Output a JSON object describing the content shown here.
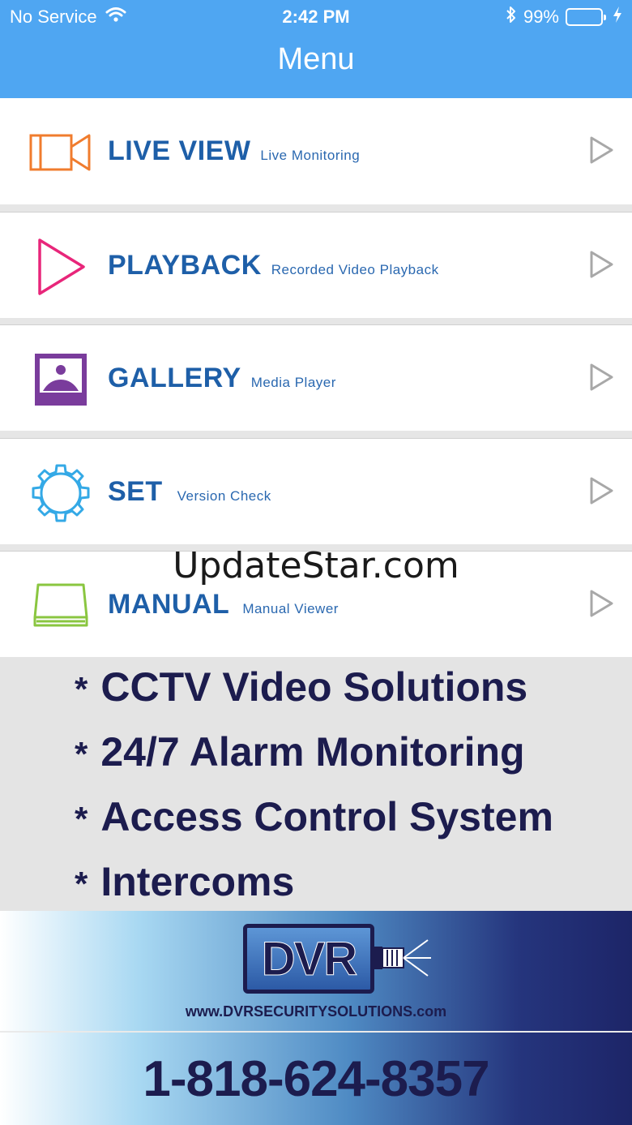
{
  "status_bar": {
    "carrier": "No Service",
    "time": "2:42 PM",
    "battery": "99%"
  },
  "header": {
    "title": "Menu"
  },
  "menu": [
    {
      "label": "LIVE VIEW",
      "sub": "Live Monitoring",
      "icon": "video-camera-icon",
      "color": "#f07c2e"
    },
    {
      "label": "PLAYBACK",
      "sub": "Recorded Video Playback",
      "icon": "play-icon",
      "color": "#e8267a"
    },
    {
      "label": "GALLERY",
      "sub": "Media Player",
      "icon": "image-icon",
      "color": "#7a3c9c"
    },
    {
      "label": "SET",
      "sub": "Version Check",
      "icon": "gear-icon",
      "color": "#34a9e6"
    },
    {
      "label": "MANUAL",
      "sub": "Manual Viewer",
      "icon": "book-icon",
      "color": "#8ac640"
    }
  ],
  "watermark": "UpdateStar.com",
  "services": {
    "star": "*",
    "lines": [
      "CCTV Video Solutions",
      "24/7 Alarm Monitoring",
      "Access Control System",
      "Intercoms"
    ]
  },
  "banner": {
    "logo_text": "DVR",
    "website": "www.DVRSECURITYSOLUTIONS.com",
    "phone": "1-818-624-8357"
  }
}
